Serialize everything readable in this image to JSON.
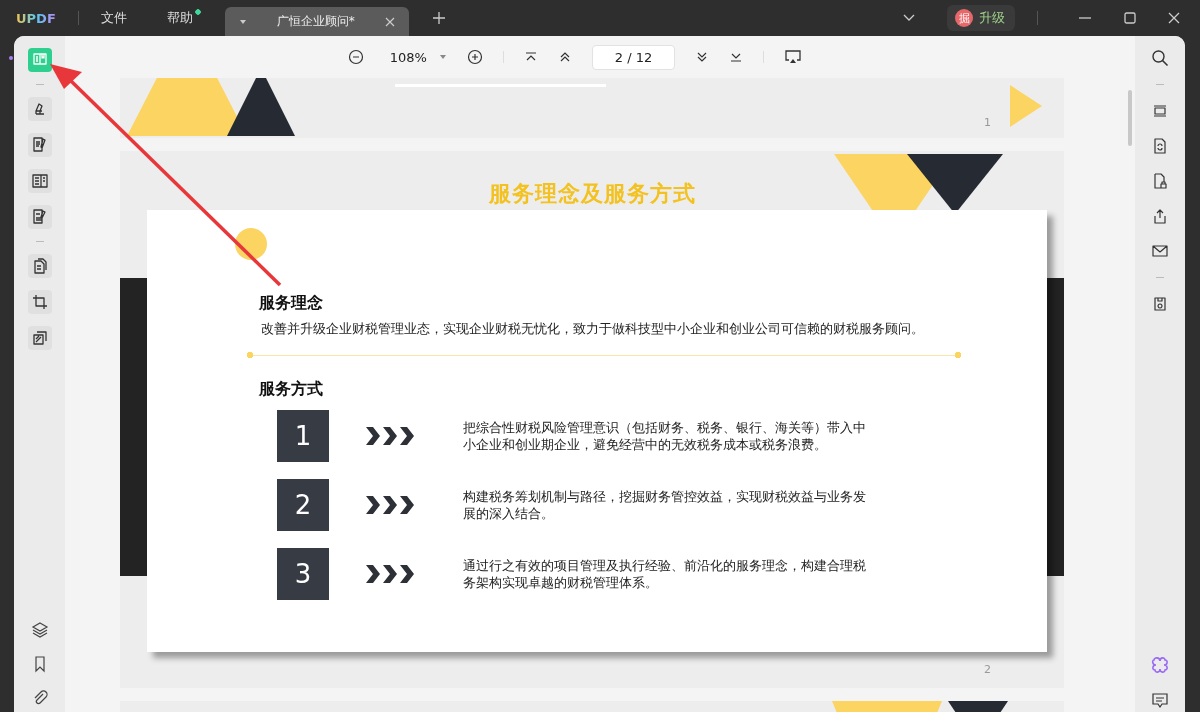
{
  "titlebar": {
    "logo": "UPDF",
    "menus": [
      {
        "label": "文件",
        "notified": false
      },
      {
        "label": "帮助",
        "notified": true
      }
    ],
    "tabs": [
      {
        "label": "广恒企业顾问*",
        "selected": true
      }
    ],
    "upgrade": {
      "avatar": "掘",
      "label": "升级"
    }
  },
  "toolbar": {
    "zoom": "108%",
    "page": "2 / 12"
  },
  "left_tools": [
    {
      "selected": true
    },
    {
      "selected": false
    },
    {
      "selected": false
    },
    {
      "selected": false
    },
    {
      "selected": false
    },
    {
      "selected": false
    },
    {
      "selected": false
    },
    {
      "selected": false
    }
  ],
  "pages": [
    {
      "number": "1"
    },
    {
      "number": "2",
      "title": "服务理念及服务方式",
      "sections": [
        {
          "heading": "服务理念",
          "text": "改善并升级企业财税管理业态，实现企业财税无忧化，致力于做科技型中小企业和创业公司可信赖的财税服务顾问。"
        },
        {
          "heading": "服务方式",
          "items": [
            {
              "number": "1",
              "text": "把综合性财税风险管理意识（包括财务、税务、银行、海关等）带入中小企业和创业期企业，避免经营中的无效税务成本或税务浪费。"
            },
            {
              "number": "2",
              "text": "构建税务筹划机制与路径，挖掘财务管控效益，实现财税效益与业务发展的深入结合。"
            },
            {
              "number": "3",
              "text": "通过行之有效的项目管理及执行经验、前沿化的服务理念，构建合理税务架构实现卓越的财税管理体系。"
            }
          ]
        }
      ]
    }
  ]
}
